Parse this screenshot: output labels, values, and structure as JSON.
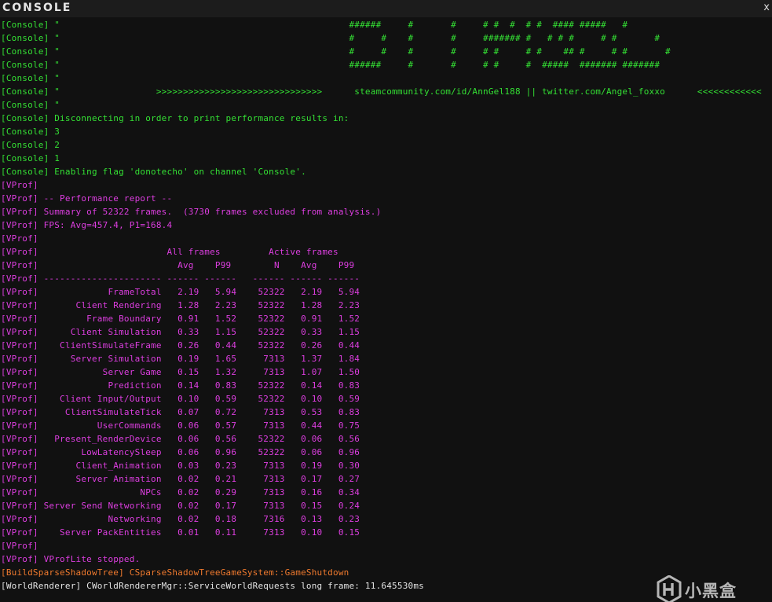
{
  "window": {
    "title": "CONSOLE",
    "close_glyph": "x"
  },
  "colors": {
    "background": "#111111",
    "console_tag": "#34e034",
    "vprof_tag": "#dd3ee0",
    "build_tag": "#f07a2e",
    "renderer_tag": "#e4e4e4"
  },
  "lines": [
    {
      "color": "green",
      "text": "[Console] \"                                                      ######     #       #     # #  #  # #  #### #####   #"
    },
    {
      "color": "green",
      "text": "[Console] \"                                                      #     #    #       #     ####### #   # # #     # #       #"
    },
    {
      "color": "green",
      "text": "[Console] \"                                                      #     #    #       #     # #     # #    ## #     # #       #"
    },
    {
      "color": "green",
      "text": "[Console] \"                                                      ######     #       #     # #     #  #####  ####### #######"
    },
    {
      "color": "green",
      "text": "[Console] \""
    },
    {
      "color": "green",
      "text": "[Console] \"                  >>>>>>>>>>>>>>>>>>>>>>>>>>>>>>>      steamcommunity.com/id/AnnGel188 || twitter.com/Angel_foxxo      <<<<<<<<<<<<"
    },
    {
      "color": "green",
      "text": "[Console] \""
    },
    {
      "color": "green",
      "text": "[Console] Disconnecting in order to print performance results in:"
    },
    {
      "color": "green",
      "text": "[Console] 3"
    },
    {
      "color": "green",
      "text": "[Console] 2"
    },
    {
      "color": "green",
      "text": "[Console] 1"
    },
    {
      "color": "green",
      "text": "[Console] Enabling flag 'donotecho' on channel 'Console'."
    },
    {
      "color": "magenta",
      "text": "[VProf]"
    },
    {
      "color": "magenta",
      "text": "[VProf] -- Performance report --"
    },
    {
      "color": "magenta",
      "text": "[VProf] Summary of 52322 frames.  (3730 frames excluded from analysis.)"
    },
    {
      "color": "magenta",
      "text": "[VProf] FPS: Avg=457.4, P1=168.4"
    },
    {
      "color": "magenta",
      "text": "[VProf]"
    },
    {
      "color": "magenta",
      "text": "[VProf]                        All frames         Active frames"
    },
    {
      "color": "magenta",
      "text": "[VProf]                          Avg    P99        N    Avg    P99"
    },
    {
      "color": "magenta",
      "text": "[VProf] ---------------------- ------ ------   ------ ------ ------"
    },
    {
      "color": "magenta",
      "text": "[VProf]             FrameTotal   2.19   5.94    52322   2.19   5.94"
    },
    {
      "color": "magenta",
      "text": "[VProf]       Client Rendering   1.28   2.23    52322   1.28   2.23"
    },
    {
      "color": "magenta",
      "text": "[VProf]         Frame Boundary   0.91   1.52    52322   0.91   1.52"
    },
    {
      "color": "magenta",
      "text": "[VProf]      Client Simulation   0.33   1.15    52322   0.33   1.15"
    },
    {
      "color": "magenta",
      "text": "[VProf]    ClientSimulateFrame   0.26   0.44    52322   0.26   0.44"
    },
    {
      "color": "magenta",
      "text": "[VProf]      Server Simulation   0.19   1.65     7313   1.37   1.84"
    },
    {
      "color": "magenta",
      "text": "[VProf]            Server Game   0.15   1.32     7313   1.07   1.50"
    },
    {
      "color": "magenta",
      "text": "[VProf]             Prediction   0.14   0.83    52322   0.14   0.83"
    },
    {
      "color": "magenta",
      "text": "[VProf]    Client Input/Output   0.10   0.59    52322   0.10   0.59"
    },
    {
      "color": "magenta",
      "text": "[VProf]     ClientSimulateTick   0.07   0.72     7313   0.53   0.83"
    },
    {
      "color": "magenta",
      "text": "[VProf]           UserCommands   0.06   0.57     7313   0.44   0.75"
    },
    {
      "color": "magenta",
      "text": "[VProf]   Present_RenderDevice   0.06   0.56    52322   0.06   0.56"
    },
    {
      "color": "magenta",
      "text": "[VProf]        LowLatencySleep   0.06   0.96    52322   0.06   0.96"
    },
    {
      "color": "magenta",
      "text": "[VProf]       Client_Animation   0.03   0.23     7313   0.19   0.30"
    },
    {
      "color": "magenta",
      "text": "[VProf]       Server Animation   0.02   0.21     7313   0.17   0.27"
    },
    {
      "color": "magenta",
      "text": "[VProf]                   NPCs   0.02   0.29     7313   0.16   0.34"
    },
    {
      "color": "magenta",
      "text": "[VProf] Server Send Networking   0.02   0.17     7313   0.15   0.24"
    },
    {
      "color": "magenta",
      "text": "[VProf]             Networking   0.02   0.18     7316   0.13   0.23"
    },
    {
      "color": "magenta",
      "text": "[VProf]    Server PackEntities   0.01   0.11     7313   0.10   0.15"
    },
    {
      "color": "magenta",
      "text": "[VProf]"
    },
    {
      "color": "magenta",
      "text": "[VProf] VProfLite stopped."
    },
    {
      "color": "orange",
      "text": "[BuildSparseShadowTree] CSparseShadowTreeGameSystem::GameShutdown"
    },
    {
      "color": "white",
      "text": "[WorldRenderer] CWorldRendererMgr::ServiceWorldRequests long frame: 11.645530ms"
    }
  ],
  "watermark": {
    "text": "小黑盒",
    "icon": "heybox-logo-icon"
  }
}
